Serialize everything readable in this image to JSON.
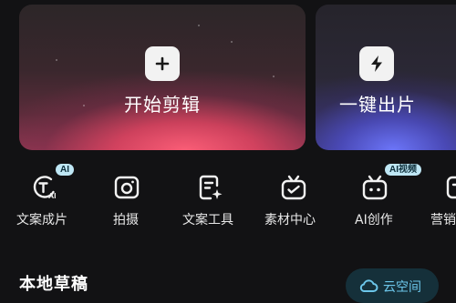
{
  "cards": {
    "start_edit": {
      "label": "开始剪辑",
      "icon": "plus-icon"
    },
    "one_click": {
      "label": "一键出片",
      "icon": "lightning-icon"
    }
  },
  "tools": [
    {
      "label": "文案成片",
      "icon": "text-to-video-icon",
      "badge": "AI"
    },
    {
      "label": "拍摄",
      "icon": "camera-icon",
      "badge": ""
    },
    {
      "label": "文案工具",
      "icon": "text-tool-icon",
      "badge": ""
    },
    {
      "label": "素材中心",
      "icon": "material-center-icon",
      "badge": ""
    },
    {
      "label": "AI创作",
      "icon": "ai-create-icon",
      "badge": "AI视频"
    },
    {
      "label": "营销",
      "icon": "marketing-icon",
      "badge": ""
    }
  ],
  "drafts": {
    "title": "本地草稿",
    "cloud_button": "云空间"
  },
  "colors": {
    "background": "#121214",
    "badge_bg": "#bfe7f5",
    "cloud_accent": "#6cc6ea"
  }
}
